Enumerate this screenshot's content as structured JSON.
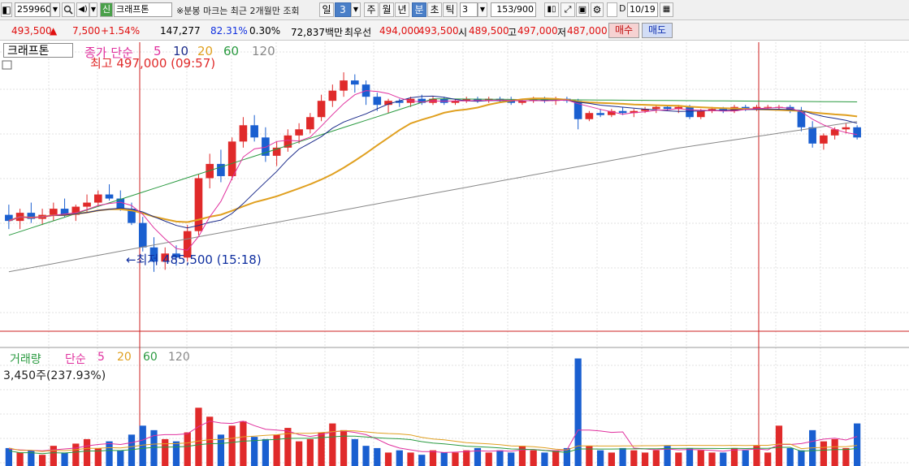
{
  "toolbar": {
    "code": "259960",
    "badge": "신",
    "name": "크래프톤",
    "notice": "※분봉 마크는 최근 2개월만 조회",
    "tab_day": "일",
    "period_value": "3",
    "tab_week": "주",
    "tab_month": "월",
    "tab_year": "년",
    "tab_minute": "분",
    "tab_second": "초",
    "tab_tick": "틱",
    "interval": "3",
    "count": "153/900",
    "date": "10/19"
  },
  "quote": {
    "price": "493,500",
    "arrow": "▲",
    "change": "7,500",
    "change_pct": "+1.54%",
    "volume": "147,277",
    "ratio": "82.31%",
    "rate2": "0.30%",
    "amount": "72,837백만",
    "best_label": "최우선",
    "best_ask": "494,000",
    "best_bid": "493,500",
    "open_label": "시",
    "open": "489,500",
    "high_label": "고",
    "high": "497,000",
    "low_label": "저",
    "low": "487,000",
    "sell_button": "매수",
    "buy_button": "매도"
  },
  "price_panel": {
    "title_box": "크래프톤",
    "ma_label": "종가 단순",
    "ma_periods": [
      "5",
      "10",
      "20",
      "60",
      "120"
    ],
    "high_marker": "최고 497,000 (09:57)",
    "low_marker": "최저 485,500 (15:18)"
  },
  "volume_panel": {
    "title": "거래량",
    "ma_label": "단순",
    "ma_periods": [
      "5",
      "20",
      "60",
      "120"
    ],
    "volume_readout": "3,450주(237.93%)"
  },
  "colors": {
    "up": "#e02a2a",
    "down": "#1a5fd0",
    "ma5": "#e0309e",
    "ma10": "#1a2a8a",
    "ma20": "#e0a020",
    "ma60": "#2a9a40",
    "ma120": "#888888",
    "separator": "#cc2020"
  },
  "chart_data": {
    "type": "candlestick",
    "price_axis": [
      485000,
      498000
    ],
    "candles": [
      [
        490000,
        490500,
        489300,
        489700
      ],
      [
        489700,
        490300,
        489300,
        490100
      ],
      [
        490100,
        490600,
        489600,
        489800
      ],
      [
        489800,
        490300,
        489500,
        490000
      ],
      [
        490000,
        490600,
        489700,
        490300
      ],
      [
        490300,
        490800,
        489900,
        490000
      ],
      [
        490000,
        490500,
        489700,
        490400
      ],
      [
        490400,
        491000,
        490100,
        490600
      ],
      [
        490600,
        491200,
        490400,
        491000
      ],
      [
        491000,
        491500,
        490700,
        490800
      ],
      [
        490800,
        491200,
        490200,
        490300
      ],
      [
        490300,
        490600,
        489500,
        489600
      ],
      [
        489600,
        489900,
        488200,
        488400
      ],
      [
        488400,
        488900,
        487200,
        487700
      ],
      [
        487700,
        488400,
        487300,
        488100
      ],
      [
        488100,
        488500,
        487500,
        487900
      ],
      [
        487900,
        489500,
        487700,
        489200
      ],
      [
        489200,
        492000,
        489000,
        491800
      ],
      [
        491800,
        493000,
        491300,
        492500
      ],
      [
        492500,
        493200,
        491600,
        491900
      ],
      [
        491900,
        493800,
        491700,
        493600
      ],
      [
        493600,
        494800,
        493300,
        494400
      ],
      [
        494400,
        494900,
        493600,
        493800
      ],
      [
        493800,
        494300,
        492600,
        492900
      ],
      [
        492900,
        493600,
        492400,
        493300
      ],
      [
        493300,
        494200,
        493100,
        493900
      ],
      [
        493900,
        494500,
        493500,
        494200
      ],
      [
        494200,
        495000,
        494000,
        494800
      ],
      [
        494800,
        495900,
        494600,
        495600
      ],
      [
        495600,
        496400,
        495300,
        496100
      ],
      [
        496100,
        497000,
        495800,
        496600
      ],
      [
        496600,
        496900,
        496000,
        496400
      ],
      [
        496400,
        496600,
        495400,
        495800
      ],
      [
        495800,
        496000,
        495100,
        495400
      ],
      [
        495400,
        495700,
        495000,
        495600
      ],
      [
        495600,
        495700,
        495300,
        495500
      ],
      [
        495500,
        495800,
        495300,
        495700
      ],
      [
        495700,
        495900,
        495400,
        495500
      ],
      [
        495500,
        495800,
        495400,
        495700
      ],
      [
        495700,
        495800,
        495400,
        495500
      ],
      [
        495500,
        495700,
        495400,
        495600
      ],
      [
        495600,
        495800,
        495500,
        495700
      ],
      [
        495700,
        495800,
        495500,
        495600
      ],
      [
        495600,
        495800,
        495500,
        495700
      ],
      [
        495700,
        495800,
        495500,
        495600
      ],
      [
        495600,
        495800,
        495400,
        495500
      ],
      [
        495500,
        495700,
        495400,
        495600
      ],
      [
        495600,
        495800,
        495500,
        495700
      ],
      [
        495700,
        495800,
        495500,
        495600
      ],
      [
        495600,
        495800,
        495400,
        495700
      ],
      [
        495700,
        495800,
        495500,
        495600
      ],
      [
        495600,
        495700,
        494200,
        494700
      ],
      [
        494700,
        495100,
        494600,
        495000
      ],
      [
        495000,
        495200,
        494800,
        494900
      ],
      [
        494900,
        495200,
        494800,
        495100
      ],
      [
        495100,
        495300,
        494900,
        495000
      ],
      [
        495000,
        495200,
        494800,
        495100
      ],
      [
        495100,
        495300,
        495000,
        495200
      ],
      [
        495200,
        495400,
        495000,
        495300
      ],
      [
        495300,
        495400,
        495100,
        495200
      ],
      [
        495200,
        495400,
        495000,
        495300
      ],
      [
        495300,
        495400,
        494700,
        494800
      ],
      [
        494800,
        495200,
        494700,
        495100
      ],
      [
        495100,
        495300,
        495000,
        495200
      ],
      [
        495200,
        495300,
        495000,
        495100
      ],
      [
        495100,
        495400,
        495000,
        495300
      ],
      [
        495300,
        495400,
        495100,
        495200
      ],
      [
        495200,
        495400,
        495100,
        495300
      ],
      [
        495300,
        495400,
        495200,
        495300
      ],
      [
        495300,
        495400,
        495200,
        495300
      ],
      [
        495300,
        495400,
        495000,
        495100
      ],
      [
        495100,
        495300,
        494100,
        494300
      ],
      [
        494300,
        494600,
        493300,
        493500
      ],
      [
        493500,
        494000,
        493200,
        493900
      ],
      [
        493900,
        494300,
        493700,
        494200
      ],
      [
        494200,
        494500,
        494000,
        494300
      ],
      [
        494300,
        494400,
        493700,
        493800
      ]
    ],
    "volumes": [
      40,
      30,
      35,
      25,
      45,
      30,
      50,
      60,
      40,
      55,
      35,
      70,
      90,
      80,
      60,
      55,
      75,
      130,
      110,
      70,
      90,
      100,
      65,
      60,
      70,
      85,
      55,
      60,
      75,
      95,
      80,
      60,
      45,
      40,
      30,
      35,
      30,
      25,
      35,
      30,
      30,
      35,
      40,
      30,
      35,
      30,
      45,
      35,
      30,
      35,
      40,
      240,
      45,
      35,
      30,
      40,
      35,
      30,
      35,
      45,
      30,
      40,
      35,
      30,
      30,
      40,
      35,
      45,
      30,
      90,
      40,
      35,
      80,
      55,
      60,
      40,
      95
    ],
    "volume_ma5": [
      38,
      36,
      35,
      34,
      36,
      38,
      40,
      45,
      48,
      50,
      48,
      52,
      58,
      68,
      70,
      70,
      72,
      88,
      100,
      96,
      95,
      100,
      90,
      82,
      80,
      78,
      70,
      66,
      70,
      76,
      78,
      75,
      70,
      60,
      48,
      40,
      36,
      32,
      32,
      30,
      31,
      32,
      34,
      33,
      34,
      33,
      36,
      37,
      35,
      34,
      36,
      80,
      80,
      78,
      75,
      76,
      40,
      38,
      36,
      38,
      36,
      37,
      36,
      35,
      33,
      36,
      36,
      38,
      36,
      48,
      48,
      50,
      55,
      60,
      62,
      58,
      66
    ]
  }
}
